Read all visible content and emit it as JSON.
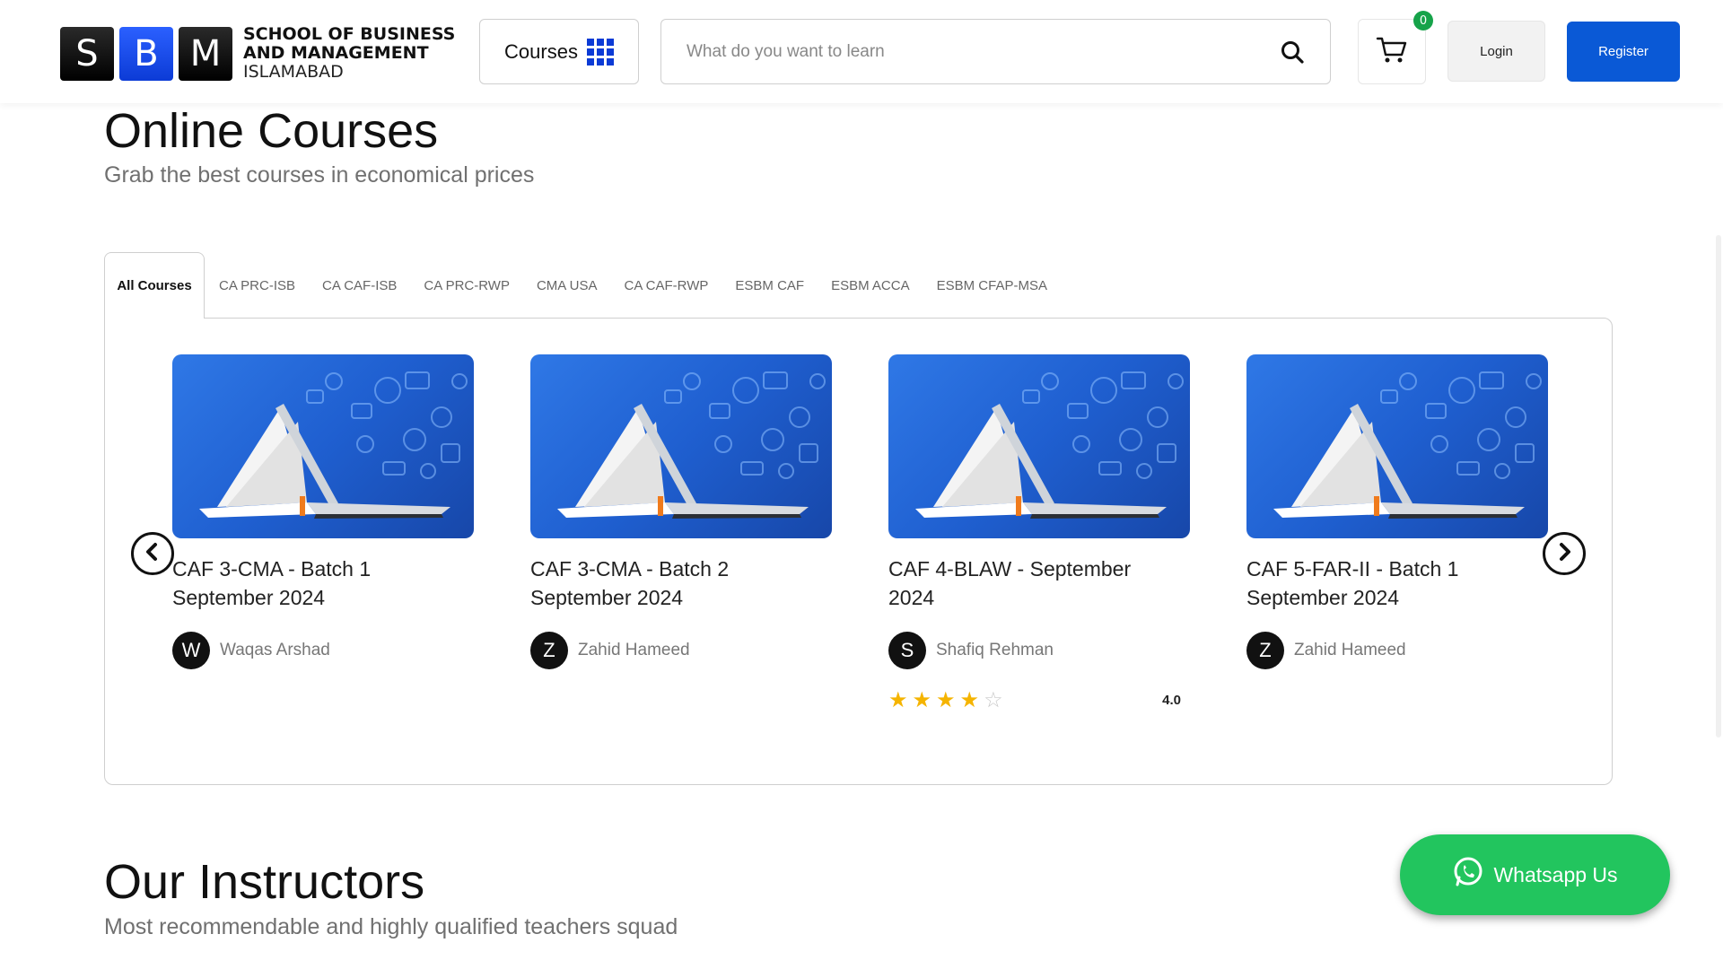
{
  "header": {
    "logo_letters": [
      "S",
      "B",
      "M"
    ],
    "logo_line1": "SCHOOL OF BUSINESS",
    "logo_line2": "AND MANAGEMENT",
    "logo_line3": "ISLAMABAD",
    "courses_label": "Courses",
    "search_placeholder": "What do you want to learn",
    "cart_count": "0",
    "login_label": "Login",
    "register_label": "Register"
  },
  "online": {
    "title": "Online Courses",
    "subtitle": "Grab the best courses in economical prices"
  },
  "tabs": [
    {
      "label": "All Courses",
      "active": true
    },
    {
      "label": "CA PRC-ISB"
    },
    {
      "label": "CA CAF-ISB"
    },
    {
      "label": "CA PRC-RWP"
    },
    {
      "label": "CMA USA"
    },
    {
      "label": "CA CAF-RWP"
    },
    {
      "label": "ESBM CAF"
    },
    {
      "label": "ESBM ACCA"
    },
    {
      "label": "ESBM CFAP-MSA"
    }
  ],
  "courses": [
    {
      "title_line1": "CAF 3-CMA - Batch 1",
      "title_line2": "September 2024",
      "instructor_initial": "W",
      "instructor": "Waqas Arshad"
    },
    {
      "title_line1": "CAF 3-CMA - Batch 2",
      "title_line2": "September 2024",
      "instructor_initial": "Z",
      "instructor": "Zahid Hameed"
    },
    {
      "title_line1": "CAF 4-BLAW - September",
      "title_line2": "2024",
      "instructor_initial": "S",
      "instructor": "Shafiq Rehman",
      "rating": "4.0",
      "stars_filled": 4,
      "stars_total": 5
    },
    {
      "title_line1": "CAF 5-FAR-II - Batch 1",
      "title_line2": "September 2024",
      "instructor_initial": "Z",
      "instructor": "Zahid Hameed"
    }
  ],
  "instructors": {
    "title": "Our Instructors",
    "subtitle": "Most recommendable and highly qualified teachers squad"
  },
  "whatsapp_label": "Whatsapp Us",
  "colors": {
    "brand_blue": "#0a59d6",
    "whatsapp_green": "#22c55e",
    "star": "#f5b400"
  }
}
